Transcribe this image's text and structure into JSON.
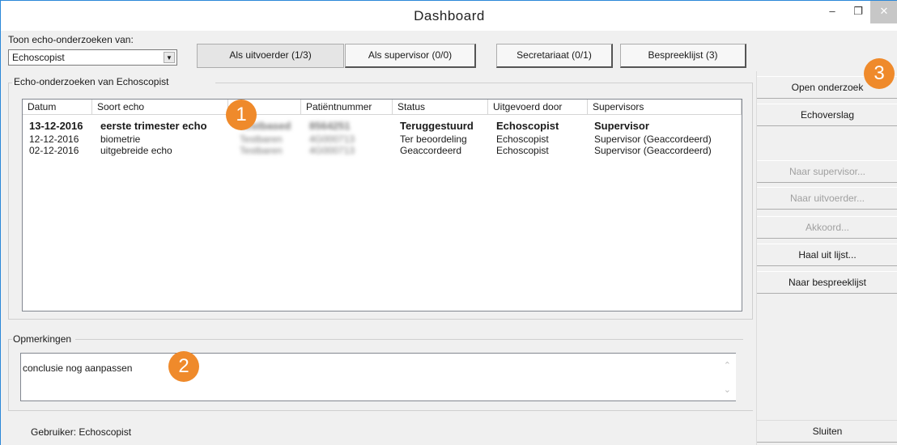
{
  "window": {
    "title": "Dashboard",
    "minimize_glyph": "–",
    "maximize_glyph": "❐",
    "close_glyph": "✕"
  },
  "filter": {
    "label": "Toon echo-onderzoeken van:",
    "selected": "Echoscopist",
    "dropdown_glyph": "▼"
  },
  "tabs": [
    {
      "label": "Als uitvoerder (1/3)",
      "active": true
    },
    {
      "label": "Als supervisor (0/0)",
      "active": false
    },
    {
      "label": "Secretariaat (0/1)",
      "active": false
    },
    {
      "label": "Bespreeklijst (3)",
      "active": false
    }
  ],
  "group_title": "Echo-onderzoeken van Echoscopist",
  "table": {
    "columns": [
      "Datum",
      "Soort echo",
      "Naam",
      "Patiëntnummer",
      "Status",
      "Uitgevoerd door",
      "Supervisors"
    ],
    "rows": [
      {
        "bold": true,
        "datum": "13-12-2016",
        "soort": "eerste trimester echo",
        "naam": "Testbased",
        "patientnummer": "8564251",
        "status": "Teruggestuurd",
        "uitgevoerd": "Echoscopist",
        "supervisors": "Supervisor"
      },
      {
        "bold": false,
        "datum": "12-12-2016",
        "soort": "biometrie",
        "naam": "Testbaren",
        "patientnummer": "4G000713",
        "status": "Ter beoordeling",
        "uitgevoerd": "Echoscopist",
        "supervisors": "Supervisor (Geaccordeerd)"
      },
      {
        "bold": false,
        "datum": "02-12-2016",
        "soort": "uitgebreide echo",
        "naam": "Testbaren",
        "patientnummer": "4G000713",
        "status": "Geaccordeerd",
        "uitgevoerd": "Echoscopist",
        "supervisors": "Supervisor (Geaccordeerd)"
      }
    ]
  },
  "side_buttons": {
    "open": "Open onderzoek",
    "verslag": "Echoverslag",
    "naar_supervisor": "Naar supervisor...",
    "naar_uitvoerder": "Naar uitvoerder...",
    "akkoord": "Akkoord...",
    "haal_uit_lijst": "Haal uit lijst...",
    "naar_bespreeklijst": "Naar bespreeklijst",
    "sluiten": "Sluiten"
  },
  "remarks": {
    "label": "Opmerkingen",
    "text": "conclusie nog aanpassen"
  },
  "status_bar": {
    "user": "Gebruiker: Echoscopist"
  },
  "badges": [
    "1",
    "2",
    "3"
  ],
  "colors": {
    "badge": "#ef8a2b",
    "window_border": "#2b88d8"
  }
}
